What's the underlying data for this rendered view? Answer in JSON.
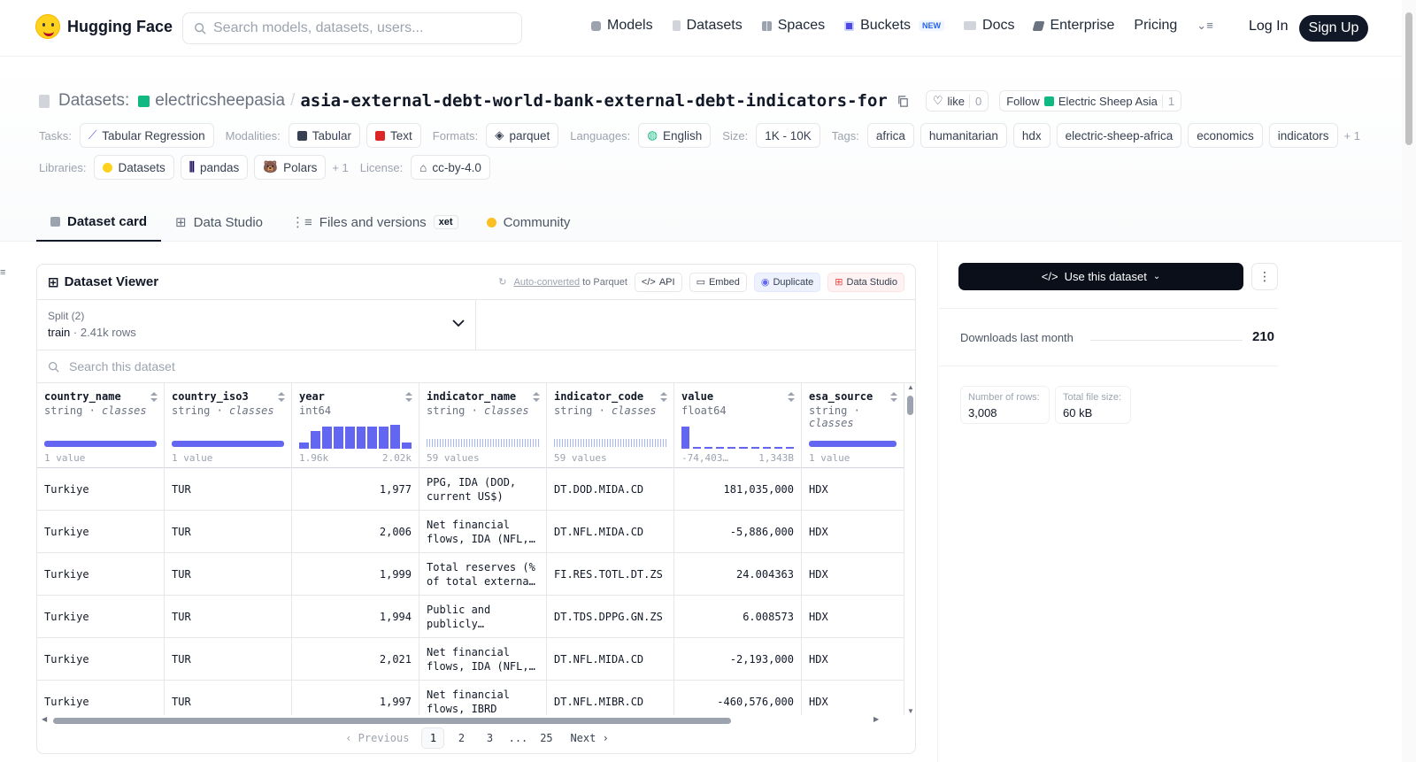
{
  "nav": {
    "brand": "Hugging Face",
    "search_placeholder": "Search models, datasets, users...",
    "items": [
      {
        "label": "Models",
        "icon": "models-icon"
      },
      {
        "label": "Datasets",
        "icon": "datasets-icon"
      },
      {
        "label": "Spaces",
        "icon": "spaces-icon"
      },
      {
        "label": "Buckets",
        "icon": "buckets-icon",
        "badge": "NEW"
      },
      {
        "label": "Docs",
        "icon": "docs-icon"
      },
      {
        "label": "Enterprise",
        "icon": "enterprise-icon"
      },
      {
        "label": "Pricing"
      }
    ],
    "login": "Log In",
    "signup": "Sign Up"
  },
  "header": {
    "section_label": "Datasets:",
    "org": "electricsheepasia",
    "separator": "/",
    "dataset_name": "asia-external-debt-world-bank-external-debt-indicators-for",
    "like_label": "like",
    "like_count": "0",
    "follow_label": "Follow",
    "follow_org": "Electric Sheep Asia",
    "follow_count": "1"
  },
  "meta": {
    "tasks_label": "Tasks:",
    "tasks": [
      "Tabular Regression"
    ],
    "modalities_label": "Modalities:",
    "modalities": [
      "Tabular",
      "Text"
    ],
    "formats_label": "Formats:",
    "formats": [
      "parquet"
    ],
    "languages_label": "Languages:",
    "languages": [
      "English"
    ],
    "size_label": "Size:",
    "size": "1K - 10K",
    "tags_label": "Tags:",
    "tags": [
      "africa",
      "humanitarian",
      "hdx",
      "electric-sheep-africa",
      "economics",
      "indicators"
    ],
    "tags_more": "+ 1",
    "libraries_label": "Libraries:",
    "libraries": [
      "Datasets",
      "pandas",
      "Polars"
    ],
    "libraries_more": "+ 1",
    "license_label": "License:",
    "license": "cc-by-4.0"
  },
  "tabs": [
    {
      "label": "Dataset card",
      "active": true
    },
    {
      "label": "Data Studio"
    },
    {
      "label": "Files and versions",
      "badge": "xet"
    },
    {
      "label": "Community"
    }
  ],
  "viewer": {
    "title": "Dataset Viewer",
    "auto_converted": "Auto-converted",
    "to_parquet": "to Parquet",
    "api": "API",
    "embed": "Embed",
    "duplicate": "Duplicate",
    "data_studio": "Data Studio",
    "split_label": "Split (2)",
    "split_name": "train",
    "split_rows": "2.41k rows",
    "search_placeholder": "Search this dataset",
    "columns": [
      {
        "name": "country_name",
        "type": "string",
        "kind": "classes",
        "foot_left": "1 value",
        "foot_right": ""
      },
      {
        "name": "country_iso3",
        "type": "string",
        "kind": "classes",
        "foot_left": "1 value",
        "foot_right": ""
      },
      {
        "name": "year",
        "type": "int64",
        "kind": "",
        "foot_left": "1.96k",
        "foot_right": "2.02k"
      },
      {
        "name": "indicator_name",
        "type": "string",
        "kind": "classes",
        "foot_left": "59 values",
        "foot_right": ""
      },
      {
        "name": "indicator_code",
        "type": "string",
        "kind": "classes",
        "foot_left": "59 values",
        "foot_right": ""
      },
      {
        "name": "value",
        "type": "float64",
        "kind": "",
        "foot_left": "-74,403…",
        "foot_right": "1,343B"
      },
      {
        "name": "esa_source",
        "type": "string",
        "kind": "classes",
        "foot_left": "1 value",
        "foot_right": ""
      }
    ],
    "rows": [
      [
        "Turkiye",
        "TUR",
        "1,977",
        "PPG, IDA (DOD, current US$)",
        "DT.DOD.MIDA.CD",
        "181,035,000",
        "HDX"
      ],
      [
        "Turkiye",
        "TUR",
        "2,006",
        "Net financial flows, IDA (NFL, current US$)",
        "DT.NFL.MIDA.CD",
        "-5,886,000",
        "HDX"
      ],
      [
        "Turkiye",
        "TUR",
        "1,999",
        "Total reserves (% of total external debt)",
        "FI.RES.TOTL.DT.ZS",
        "24.004363",
        "HDX"
      ],
      [
        "Turkiye",
        "TUR",
        "1,994",
        "Public and publicly guaranteed debt service",
        "DT.TDS.DPPG.GN.ZS",
        "6.008573",
        "HDX"
      ],
      [
        "Turkiye",
        "TUR",
        "2,021",
        "Net financial flows, IDA (NFL, current US$)",
        "DT.NFL.MIDA.CD",
        "-2,193,000",
        "HDX"
      ],
      [
        "Turkiye",
        "TUR",
        "1,997",
        "Net financial flows, IBRD",
        "DT.NFL.MIBR.CD",
        "-460,576,000",
        "HDX"
      ]
    ],
    "pager": {
      "prev": "Previous",
      "pages": [
        "1",
        "2",
        "3",
        "...",
        "25"
      ],
      "next": "Next"
    }
  },
  "sidebar": {
    "use_button": "Use this dataset",
    "downloads_label": "Downloads last month",
    "downloads_value": "210",
    "rows_label": "Number of rows:",
    "rows_value": "3,008",
    "size_label": "Total file size:",
    "size_value": "60 kB"
  }
}
